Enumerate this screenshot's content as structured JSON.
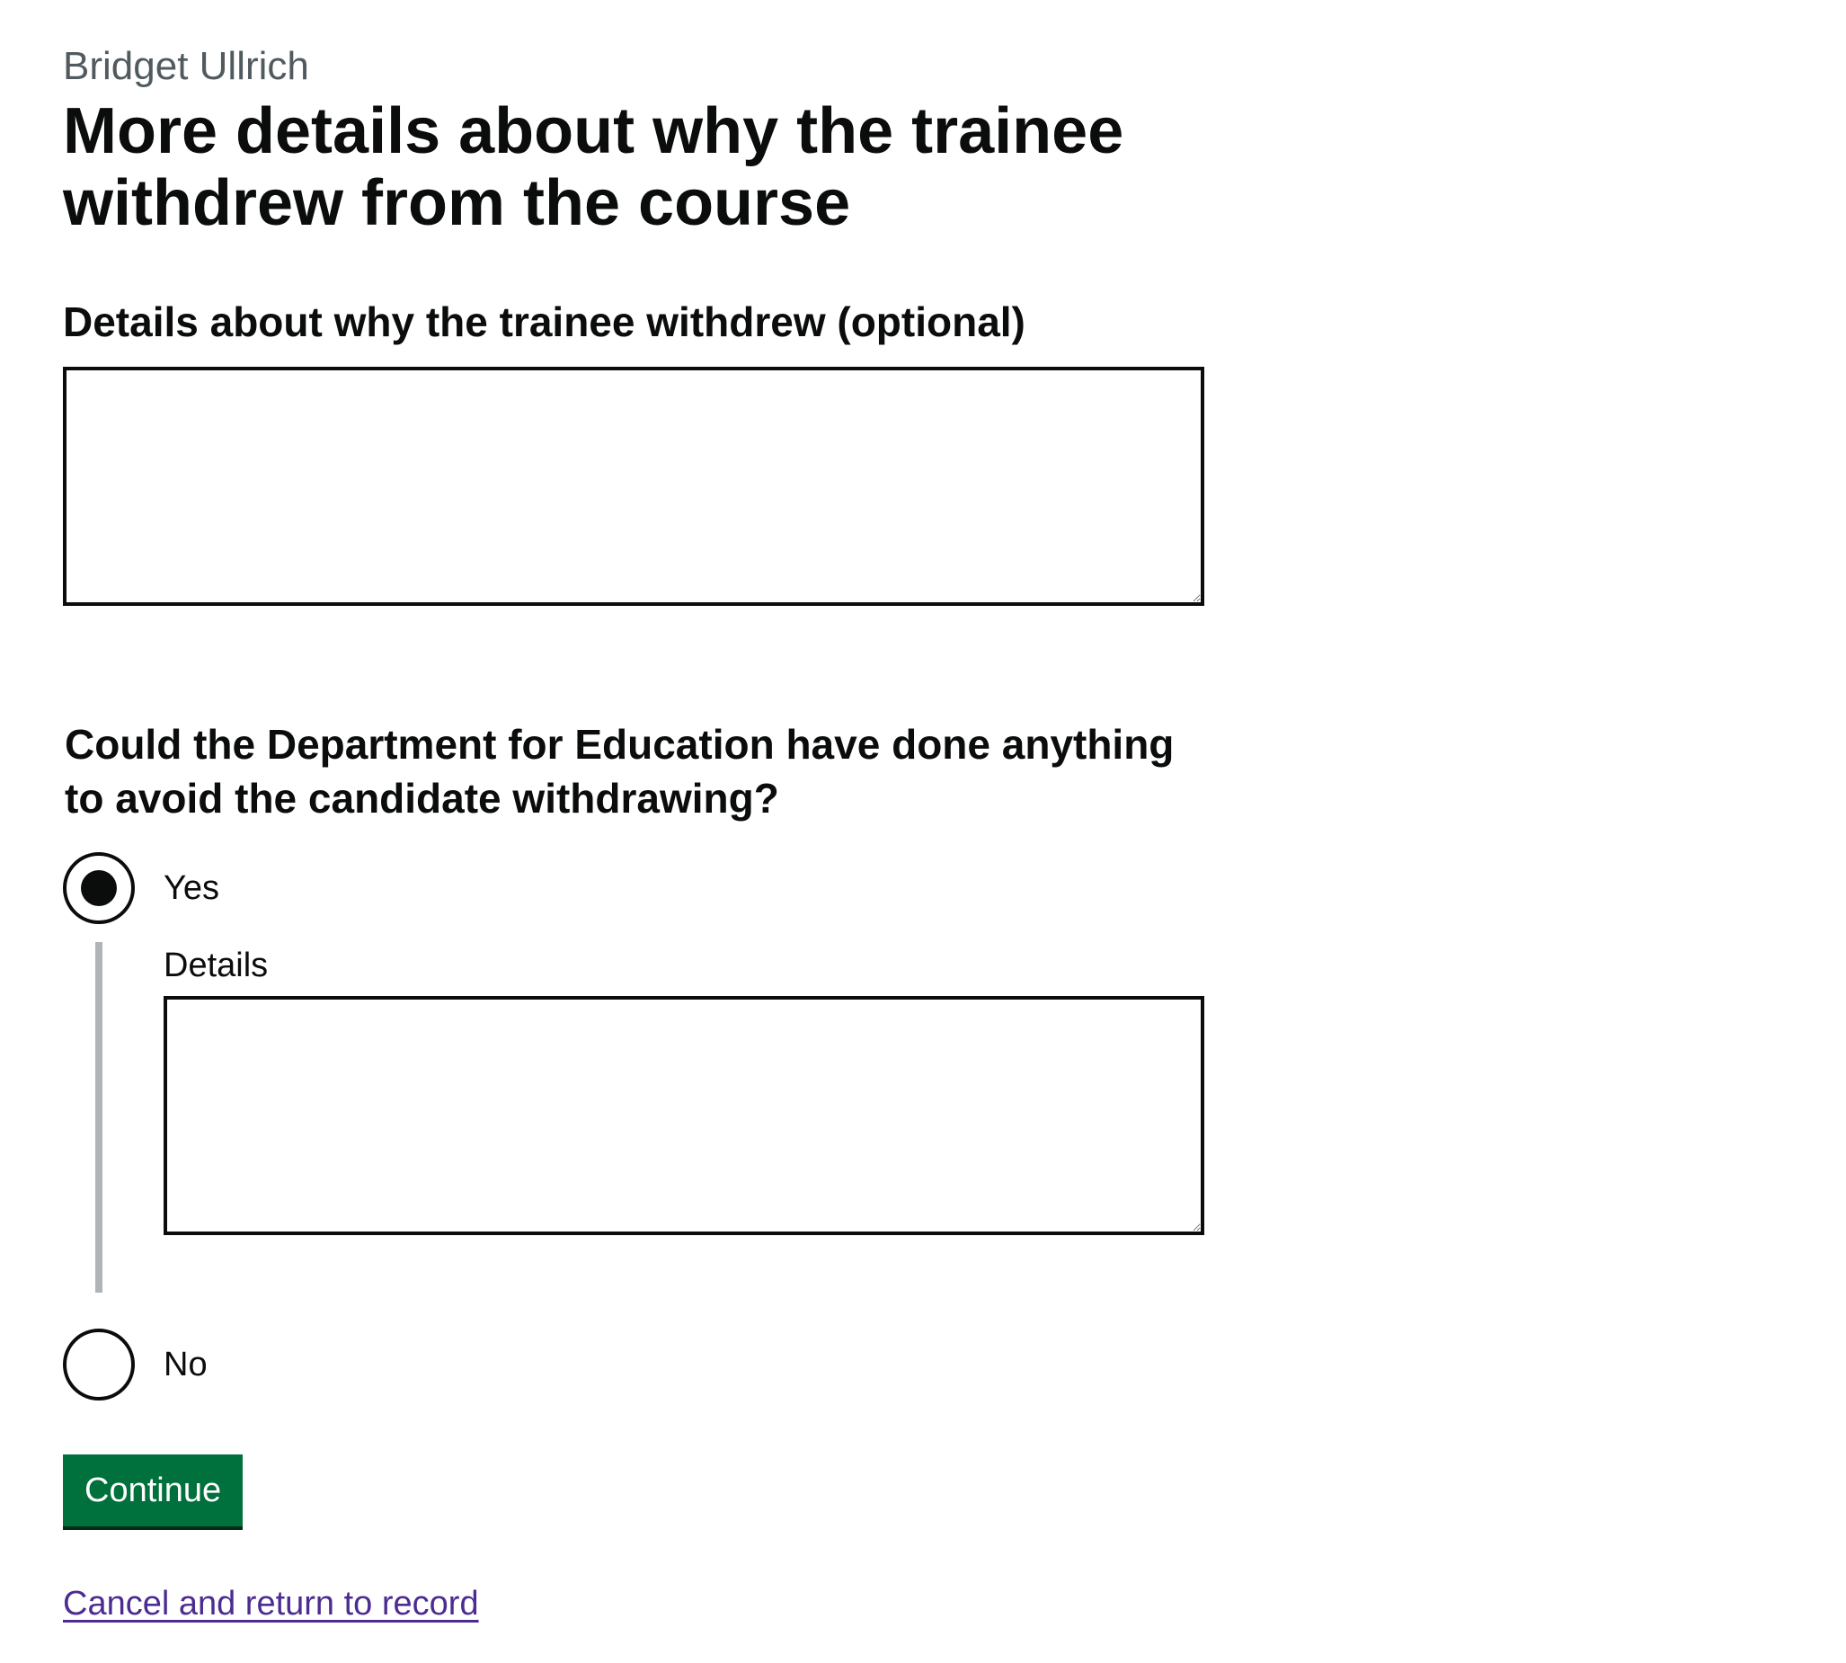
{
  "trainee": {
    "name": "Bridget Ullrich"
  },
  "page": {
    "title": "More details about why the trainee withdrew from the course"
  },
  "withdraw_details": {
    "label": "Details about why the trainee withdrew (optional)",
    "value": ""
  },
  "dfe_question": {
    "legend": "Could the Department for Education have done anything to avoid the candidate withdrawing?",
    "selected": "Yes",
    "options": [
      {
        "label": "Yes",
        "checked": true
      },
      {
        "label": "No",
        "checked": false
      }
    ],
    "conditional": {
      "label": "Details",
      "value": ""
    }
  },
  "actions": {
    "continue_label": "Continue",
    "cancel_label": "Cancel and return to record"
  },
  "colors": {
    "text": "#0b0c0c",
    "secondary_text": "#505a5f",
    "button_green": "#00703c",
    "button_shadow": "#002d18",
    "link": "#4c2c92",
    "conditional_border": "#b1b4b6"
  }
}
